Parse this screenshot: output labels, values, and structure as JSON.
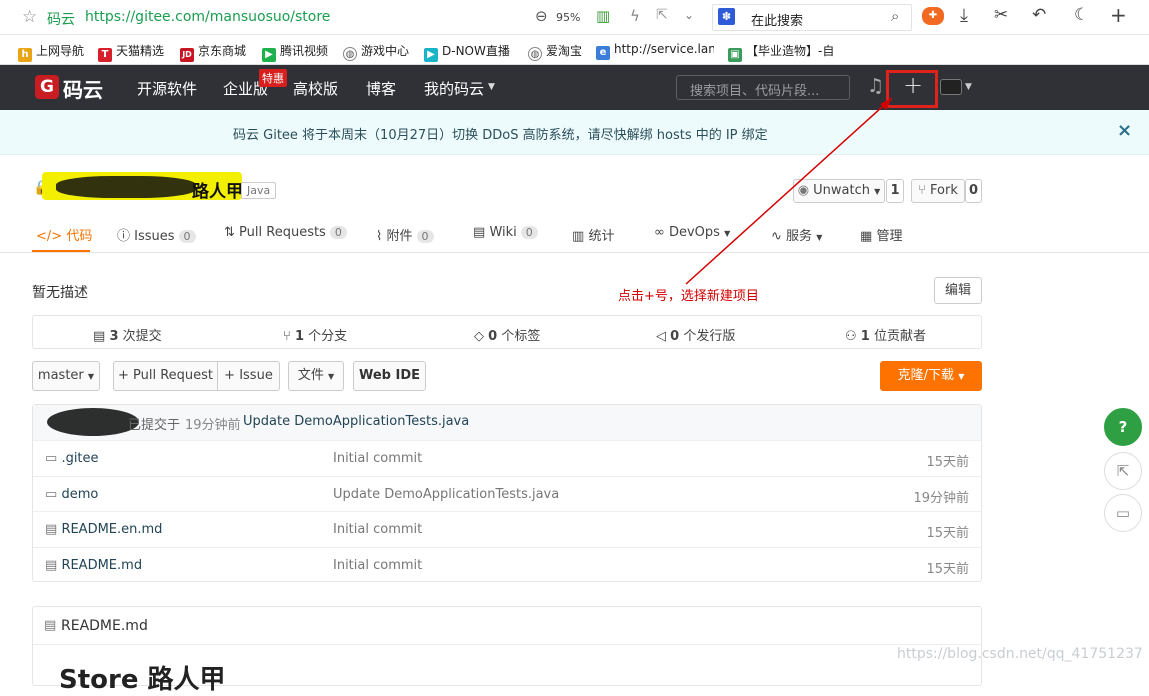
{
  "browser": {
    "site_name": "码云",
    "url": "https://gitee.com/mansuosuo/store",
    "zoom": "95%",
    "search_label": "在此搜索"
  },
  "bookmarks": [
    {
      "label": "上网导航",
      "color": "#e9a516"
    },
    {
      "label": "天猫精选",
      "color": "#d6202c",
      "glyph": "T"
    },
    {
      "label": "京东商城",
      "color": "#c91623",
      "glyph": "JD"
    },
    {
      "label": "腾讯视频",
      "color": "#1fb14b"
    },
    {
      "label": "游戏中心",
      "color": "#555555"
    },
    {
      "label": "D-NOW直播",
      "color": "#19b4c7"
    },
    {
      "label": "爱淘宝",
      "color": "#555555"
    },
    {
      "label": "http://service.lan",
      "color": "#3b7dd8"
    },
    {
      "label": "【毕业造物】-自",
      "color": "#3a9b5a"
    }
  ],
  "nav": {
    "logo_text": "码云",
    "items": [
      "开源软件",
      "企业版",
      "高校版",
      "博客",
      "我的码云"
    ],
    "promo_badge": "特惠",
    "search_placeholder": "搜索项目、代码片段..."
  },
  "notice": {
    "text": "码云 Gitee 将于本周末（10月27日）切换 DDoS 高防系统，请尽快解绑 hosts 中的 IP 绑定",
    "close": "×"
  },
  "repo": {
    "name": "路人甲",
    "language": "Java",
    "watch_label": "Unwatch",
    "watch_count": "1",
    "fork_label": "Fork",
    "fork_count": "0",
    "tabs": [
      {
        "label": "代码"
      },
      {
        "label": "Issues",
        "count": "0"
      },
      {
        "label": "Pull Requests",
        "count": "0"
      },
      {
        "label": "附件",
        "count": "0"
      },
      {
        "label": "Wiki",
        "count": "0"
      },
      {
        "label": "统计"
      },
      {
        "label": "DevOps"
      },
      {
        "label": "服务"
      },
      {
        "label": "管理"
      }
    ],
    "description": "暂无描述",
    "edit_label": "编辑",
    "annotation": "点击+号，选择新建项目",
    "stats": {
      "commits": "3",
      "commits_label": "次提交",
      "branches": "1",
      "branches_label": "个分支",
      "tags": "0",
      "tags_label": "个标签",
      "releases": "0",
      "releases_label": "个发行版",
      "contributors": "1",
      "contributors_label": "位贡献者"
    },
    "branch": "master",
    "pr_button": "+ Pull Request",
    "issue_button": "+ Issue",
    "file_button": "文件",
    "webide_button": "Web IDE",
    "clone_button": "克隆/下载",
    "last_commit": {
      "prefix": "已提交于",
      "time": "19分钟前",
      "message": "Update DemoApplicationTests.java"
    },
    "files": [
      {
        "name": ".gitee",
        "type": "folder",
        "message": "Initial commit",
        "time": "15天前"
      },
      {
        "name": "demo",
        "type": "folder",
        "message": "Update DemoApplicationTests.java",
        "time": "19分钟前"
      },
      {
        "name": "README.en.md",
        "type": "file",
        "message": "Initial commit",
        "time": "15天前"
      },
      {
        "name": "README.md",
        "type": "file",
        "message": "Initial commit",
        "time": "15天前"
      }
    ],
    "readme_title": "README.md",
    "readme_heading": "Store 路人甲"
  },
  "watermark": "https://blog.csdn.net/qq_41751237",
  "colors": {
    "accent_orange": "#fe7300",
    "annotation_red": "#d40000",
    "nav_bg": "#2f3137",
    "help_green": "#2ea043"
  }
}
